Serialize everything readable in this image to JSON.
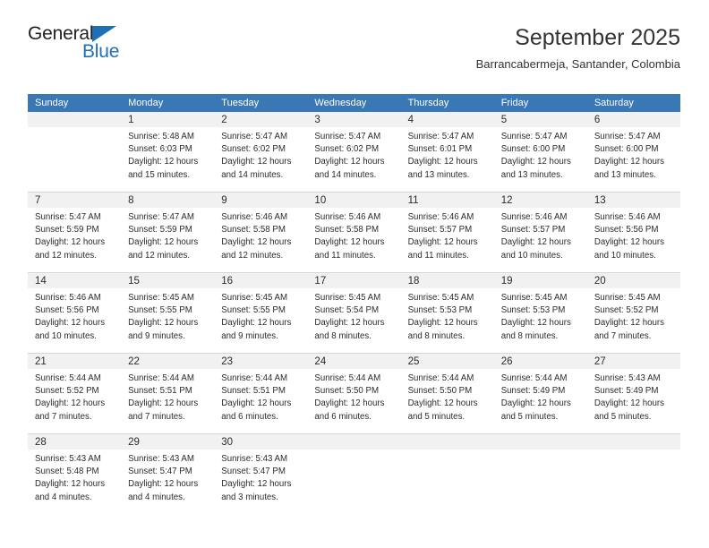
{
  "brand": {
    "name_part1": "General",
    "name_part2": "Blue",
    "logo_icon": "triangle-icon",
    "color_primary": "#1d70b8",
    "color_text": "#231f20"
  },
  "header": {
    "title": "September 2025",
    "subtitle": "Barrancabermeja, Santander, Colombia"
  },
  "calendar": {
    "header_bg": "#3a77b5",
    "daynum_bg": "#f1f1f1",
    "weekdays": [
      "Sunday",
      "Monday",
      "Tuesday",
      "Wednesday",
      "Thursday",
      "Friday",
      "Saturday"
    ],
    "weeks": [
      [
        {
          "day": "",
          "empty": true,
          "sunrise": "",
          "sunset": "",
          "daylight_line1": "",
          "daylight_line2": ""
        },
        {
          "day": "1",
          "empty": false,
          "sunrise": "Sunrise: 5:48 AM",
          "sunset": "Sunset: 6:03 PM",
          "daylight_line1": "Daylight: 12 hours",
          "daylight_line2": "and 15 minutes."
        },
        {
          "day": "2",
          "empty": false,
          "sunrise": "Sunrise: 5:47 AM",
          "sunset": "Sunset: 6:02 PM",
          "daylight_line1": "Daylight: 12 hours",
          "daylight_line2": "and 14 minutes."
        },
        {
          "day": "3",
          "empty": false,
          "sunrise": "Sunrise: 5:47 AM",
          "sunset": "Sunset: 6:02 PM",
          "daylight_line1": "Daylight: 12 hours",
          "daylight_line2": "and 14 minutes."
        },
        {
          "day": "4",
          "empty": false,
          "sunrise": "Sunrise: 5:47 AM",
          "sunset": "Sunset: 6:01 PM",
          "daylight_line1": "Daylight: 12 hours",
          "daylight_line2": "and 13 minutes."
        },
        {
          "day": "5",
          "empty": false,
          "sunrise": "Sunrise: 5:47 AM",
          "sunset": "Sunset: 6:00 PM",
          "daylight_line1": "Daylight: 12 hours",
          "daylight_line2": "and 13 minutes."
        },
        {
          "day": "6",
          "empty": false,
          "sunrise": "Sunrise: 5:47 AM",
          "sunset": "Sunset: 6:00 PM",
          "daylight_line1": "Daylight: 12 hours",
          "daylight_line2": "and 13 minutes."
        }
      ],
      [
        {
          "day": "7",
          "empty": false,
          "sunrise": "Sunrise: 5:47 AM",
          "sunset": "Sunset: 5:59 PM",
          "daylight_line1": "Daylight: 12 hours",
          "daylight_line2": "and 12 minutes."
        },
        {
          "day": "8",
          "empty": false,
          "sunrise": "Sunrise: 5:47 AM",
          "sunset": "Sunset: 5:59 PM",
          "daylight_line1": "Daylight: 12 hours",
          "daylight_line2": "and 12 minutes."
        },
        {
          "day": "9",
          "empty": false,
          "sunrise": "Sunrise: 5:46 AM",
          "sunset": "Sunset: 5:58 PM",
          "daylight_line1": "Daylight: 12 hours",
          "daylight_line2": "and 12 minutes."
        },
        {
          "day": "10",
          "empty": false,
          "sunrise": "Sunrise: 5:46 AM",
          "sunset": "Sunset: 5:58 PM",
          "daylight_line1": "Daylight: 12 hours",
          "daylight_line2": "and 11 minutes."
        },
        {
          "day": "11",
          "empty": false,
          "sunrise": "Sunrise: 5:46 AM",
          "sunset": "Sunset: 5:57 PM",
          "daylight_line1": "Daylight: 12 hours",
          "daylight_line2": "and 11 minutes."
        },
        {
          "day": "12",
          "empty": false,
          "sunrise": "Sunrise: 5:46 AM",
          "sunset": "Sunset: 5:57 PM",
          "daylight_line1": "Daylight: 12 hours",
          "daylight_line2": "and 10 minutes."
        },
        {
          "day": "13",
          "empty": false,
          "sunrise": "Sunrise: 5:46 AM",
          "sunset": "Sunset: 5:56 PM",
          "daylight_line1": "Daylight: 12 hours",
          "daylight_line2": "and 10 minutes."
        }
      ],
      [
        {
          "day": "14",
          "empty": false,
          "sunrise": "Sunrise: 5:46 AM",
          "sunset": "Sunset: 5:56 PM",
          "daylight_line1": "Daylight: 12 hours",
          "daylight_line2": "and 10 minutes."
        },
        {
          "day": "15",
          "empty": false,
          "sunrise": "Sunrise: 5:45 AM",
          "sunset": "Sunset: 5:55 PM",
          "daylight_line1": "Daylight: 12 hours",
          "daylight_line2": "and 9 minutes."
        },
        {
          "day": "16",
          "empty": false,
          "sunrise": "Sunrise: 5:45 AM",
          "sunset": "Sunset: 5:55 PM",
          "daylight_line1": "Daylight: 12 hours",
          "daylight_line2": "and 9 minutes."
        },
        {
          "day": "17",
          "empty": false,
          "sunrise": "Sunrise: 5:45 AM",
          "sunset": "Sunset: 5:54 PM",
          "daylight_line1": "Daylight: 12 hours",
          "daylight_line2": "and 8 minutes."
        },
        {
          "day": "18",
          "empty": false,
          "sunrise": "Sunrise: 5:45 AM",
          "sunset": "Sunset: 5:53 PM",
          "daylight_line1": "Daylight: 12 hours",
          "daylight_line2": "and 8 minutes."
        },
        {
          "day": "19",
          "empty": false,
          "sunrise": "Sunrise: 5:45 AM",
          "sunset": "Sunset: 5:53 PM",
          "daylight_line1": "Daylight: 12 hours",
          "daylight_line2": "and 8 minutes."
        },
        {
          "day": "20",
          "empty": false,
          "sunrise": "Sunrise: 5:45 AM",
          "sunset": "Sunset: 5:52 PM",
          "daylight_line1": "Daylight: 12 hours",
          "daylight_line2": "and 7 minutes."
        }
      ],
      [
        {
          "day": "21",
          "empty": false,
          "sunrise": "Sunrise: 5:44 AM",
          "sunset": "Sunset: 5:52 PM",
          "daylight_line1": "Daylight: 12 hours",
          "daylight_line2": "and 7 minutes."
        },
        {
          "day": "22",
          "empty": false,
          "sunrise": "Sunrise: 5:44 AM",
          "sunset": "Sunset: 5:51 PM",
          "daylight_line1": "Daylight: 12 hours",
          "daylight_line2": "and 7 minutes."
        },
        {
          "day": "23",
          "empty": false,
          "sunrise": "Sunrise: 5:44 AM",
          "sunset": "Sunset: 5:51 PM",
          "daylight_line1": "Daylight: 12 hours",
          "daylight_line2": "and 6 minutes."
        },
        {
          "day": "24",
          "empty": false,
          "sunrise": "Sunrise: 5:44 AM",
          "sunset": "Sunset: 5:50 PM",
          "daylight_line1": "Daylight: 12 hours",
          "daylight_line2": "and 6 minutes."
        },
        {
          "day": "25",
          "empty": false,
          "sunrise": "Sunrise: 5:44 AM",
          "sunset": "Sunset: 5:50 PM",
          "daylight_line1": "Daylight: 12 hours",
          "daylight_line2": "and 5 minutes."
        },
        {
          "day": "26",
          "empty": false,
          "sunrise": "Sunrise: 5:44 AM",
          "sunset": "Sunset: 5:49 PM",
          "daylight_line1": "Daylight: 12 hours",
          "daylight_line2": "and 5 minutes."
        },
        {
          "day": "27",
          "empty": false,
          "sunrise": "Sunrise: 5:43 AM",
          "sunset": "Sunset: 5:49 PM",
          "daylight_line1": "Daylight: 12 hours",
          "daylight_line2": "and 5 minutes."
        }
      ],
      [
        {
          "day": "28",
          "empty": false,
          "sunrise": "Sunrise: 5:43 AM",
          "sunset": "Sunset: 5:48 PM",
          "daylight_line1": "Daylight: 12 hours",
          "daylight_line2": "and 4 minutes."
        },
        {
          "day": "29",
          "empty": false,
          "sunrise": "Sunrise: 5:43 AM",
          "sunset": "Sunset: 5:47 PM",
          "daylight_line1": "Daylight: 12 hours",
          "daylight_line2": "and 4 minutes."
        },
        {
          "day": "30",
          "empty": false,
          "sunrise": "Sunrise: 5:43 AM",
          "sunset": "Sunset: 5:47 PM",
          "daylight_line1": "Daylight: 12 hours",
          "daylight_line2": "and 3 minutes."
        },
        {
          "day": "",
          "empty": true,
          "sunrise": "",
          "sunset": "",
          "daylight_line1": "",
          "daylight_line2": ""
        },
        {
          "day": "",
          "empty": true,
          "sunrise": "",
          "sunset": "",
          "daylight_line1": "",
          "daylight_line2": ""
        },
        {
          "day": "",
          "empty": true,
          "sunrise": "",
          "sunset": "",
          "daylight_line1": "",
          "daylight_line2": ""
        },
        {
          "day": "",
          "empty": true,
          "sunrise": "",
          "sunset": "",
          "daylight_line1": "",
          "daylight_line2": ""
        }
      ]
    ]
  }
}
